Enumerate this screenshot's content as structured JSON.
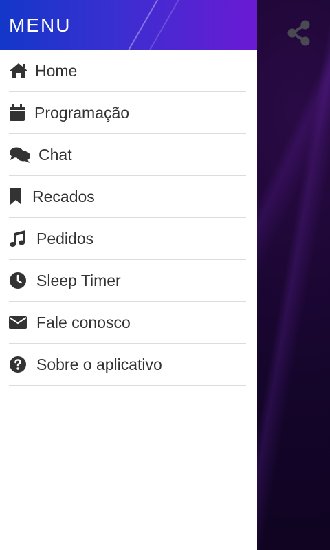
{
  "drawer": {
    "title": "MENU",
    "items": [
      {
        "label": "Home",
        "icon": "home-icon"
      },
      {
        "label": "Programação",
        "icon": "calendar-icon"
      },
      {
        "label": "Chat",
        "icon": "chat-bubbles-icon"
      },
      {
        "label": "Recados",
        "icon": "bookmark-icon"
      },
      {
        "label": "Pedidos",
        "icon": "music-note-icon"
      },
      {
        "label": "Sleep Timer",
        "icon": "clock-icon"
      },
      {
        "label": "Fale conosco",
        "icon": "envelope-icon"
      },
      {
        "label": "Sobre o aplicativo",
        "icon": "question-circle-icon"
      }
    ]
  },
  "toolbar": {
    "share_icon": "share-icon"
  },
  "colors": {
    "header_start": "#1337c9",
    "header_end": "#6b1ad4",
    "text": "#333333",
    "background_dark": "#14052a"
  }
}
